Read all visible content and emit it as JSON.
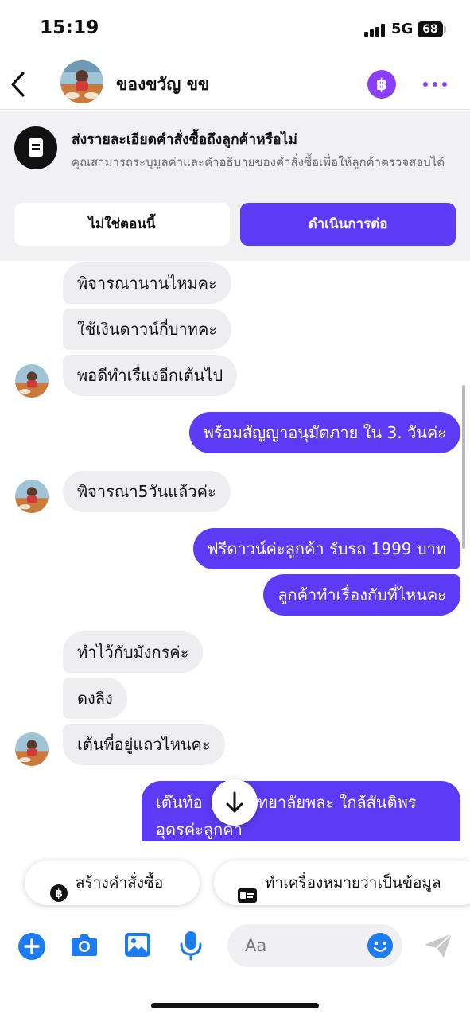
{
  "status_bar": {
    "time": "15:19",
    "network": "5G",
    "battery": "68"
  },
  "header": {
    "contact_name": "ของขวัญ ขข",
    "baht_symbol": "฿"
  },
  "banner": {
    "title": "ส่งรายละเอียดคำสั่งซื้อถึงลูกค้าหรือไม่",
    "description": "คุณสามารถระบุมูลค่าและคำอธิบายของคำสั่งซื้อเพื่อให้ลูกค้าตรวจสอบได้",
    "later_label": "ไม่ใช่ตอนนี้",
    "continue_label": "ดำเนินการต่อ"
  },
  "messages": [
    {
      "side": "in",
      "text": "พิจารณานานไหมคะ"
    },
    {
      "side": "in",
      "text": "ใช้เงินดาวน์กี่บาทคะ"
    },
    {
      "side": "in",
      "text": "พอดีทำเรื่แงอีกเต้นไป"
    },
    {
      "side": "out",
      "text": "พร้อมสัญญาอนุมัตภาย ใน 3. วันค่ะ"
    },
    {
      "side": "in",
      "text": "พิจารณา5วันแล้วค่ะ"
    },
    {
      "side": "out",
      "text": "ฟรีดาวน์ค่ะลูกค้า รับรถ 1999 บาท"
    },
    {
      "side": "out",
      "text": "ลูกค้าทำเรื่องกับที่ไหนคะ"
    },
    {
      "side": "in",
      "text": "ทำไว้กับมังกรค่ะ"
    },
    {
      "side": "in",
      "text": "ดงลิง"
    },
    {
      "side": "in",
      "text": "เต้นพี่อยู่แถวไหนคะ"
    },
    {
      "side": "out",
      "text": "เต๊นท์อ",
      "text_b": "วิทยาลัยพละ ใกล้สันติพร",
      "text_c": "อุดรค่ะลูกค้า"
    }
  ],
  "quick_actions": {
    "create_order": "สร้างคำสั่งซื้อ",
    "mark_info": "ทำเครื่องหมายว่าเป็นข้อมูล"
  },
  "composer": {
    "placeholder": "Aa"
  },
  "colors": {
    "accent": "#5b3bf5",
    "purple_icon": "#8a3ffc",
    "blue_icon": "#1d7cf2",
    "incoming_bubble": "#eeeef1"
  },
  "icons": [
    "back-icon",
    "baht-icon",
    "more-icon",
    "document-icon",
    "arrow-down-icon",
    "plus-icon",
    "camera-icon",
    "image-icon",
    "microphone-icon",
    "emoji-icon",
    "send-icon"
  ]
}
